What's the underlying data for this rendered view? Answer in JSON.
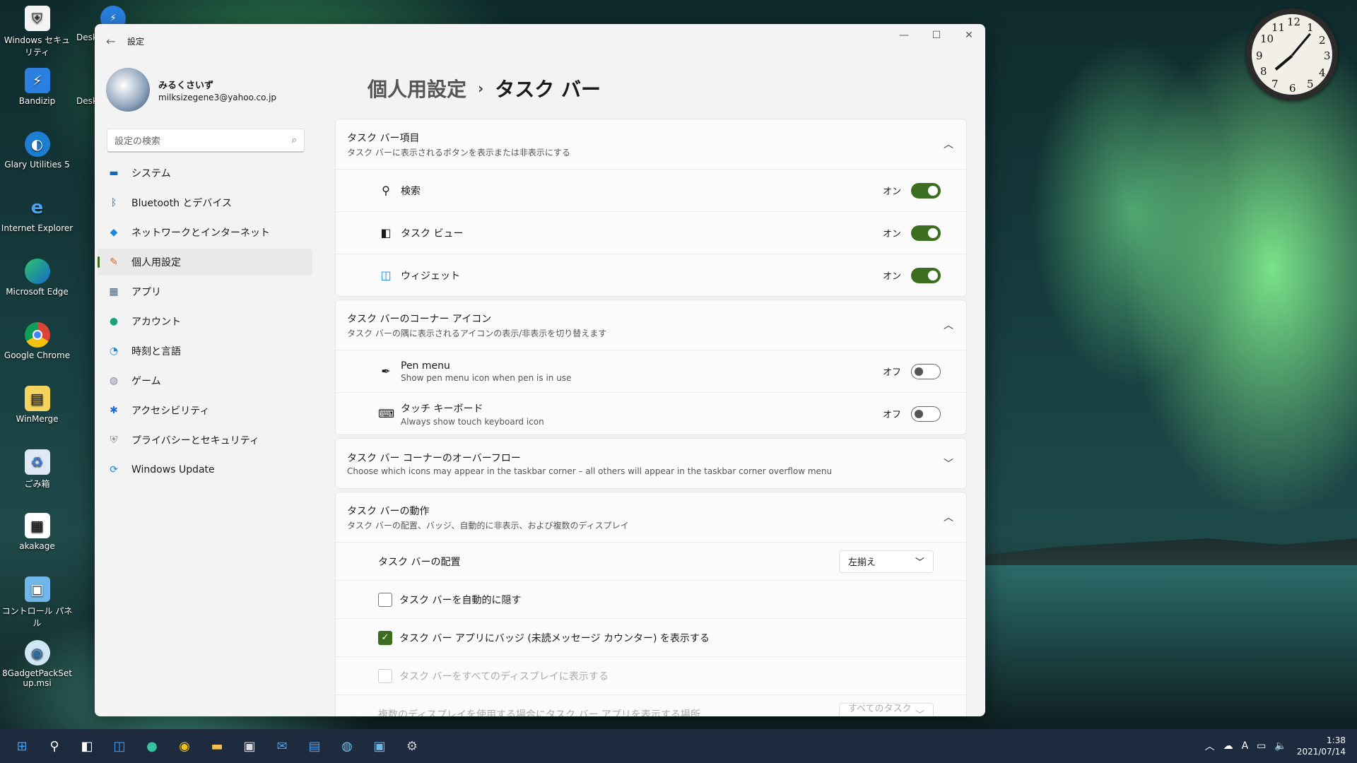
{
  "desktop": {
    "icons": [
      {
        "label": "Windows セキュリティ",
        "icon": "shield-doc-icon"
      },
      {
        "label": "Bandizip",
        "icon": "bandizip-icon"
      },
      {
        "label": "Glary Utilities 5",
        "icon": "glary-icon"
      },
      {
        "label": "Internet Explorer",
        "icon": "ie-icon"
      },
      {
        "label": "Microsoft Edge",
        "icon": "edge-icon"
      },
      {
        "label": "Google Chrome",
        "icon": "chrome-icon"
      },
      {
        "label": "WinMerge",
        "icon": "winmerge-icon"
      },
      {
        "label": "ごみ箱",
        "icon": "recycle-bin-icon"
      },
      {
        "label": "akakage",
        "icon": "akakage-icon"
      },
      {
        "label": "コントロール パネル",
        "icon": "control-panel-icon"
      },
      {
        "label": "8GadgetPackSetup.msi",
        "icon": "installer-icon"
      }
    ],
    "partial_icon_label": "Desk"
  },
  "clock_widget": {
    "numbers": [
      "12",
      "1",
      "2",
      "3",
      "4",
      "5",
      "6",
      "7",
      "8",
      "9",
      "10",
      "11"
    ]
  },
  "window": {
    "title": "設定",
    "profile": {
      "name": "みるくさいず",
      "email": "milksizegene3@yahoo.co.jp"
    },
    "search_placeholder": "設定の検索",
    "nav": [
      {
        "label": "システム",
        "icon": "system-icon",
        "color": "#0f6cbd"
      },
      {
        "label": "Bluetooth とデバイス",
        "icon": "bluetooth-icon",
        "color": "#0f6cbd"
      },
      {
        "label": "ネットワークとインターネット",
        "icon": "network-icon",
        "color": "#1b88e0"
      },
      {
        "label": "個人用設定",
        "icon": "brush-icon",
        "color": "#c46a2c"
      },
      {
        "label": "アプリ",
        "icon": "apps-icon",
        "color": "#4a5f78"
      },
      {
        "label": "アカウント",
        "icon": "account-icon",
        "color": "#1aa17b"
      },
      {
        "label": "時刻と言語",
        "icon": "time-language-icon",
        "color": "#1b88e0"
      },
      {
        "label": "ゲーム",
        "icon": "gaming-icon",
        "color": "#7a8594"
      },
      {
        "label": "アクセシビリティ",
        "icon": "accessibility-icon",
        "color": "#1b6ed6"
      },
      {
        "label": "プライバシーとセキュリティ",
        "icon": "privacy-shield-icon",
        "color": "#7d8792"
      },
      {
        "label": "Windows Update",
        "icon": "update-icon",
        "color": "#1b88e0"
      }
    ],
    "active_nav_index": 3,
    "breadcrumb": {
      "parent": "個人用設定",
      "separator": "›",
      "current": "タスク バー"
    },
    "sections": {
      "items": {
        "title": "タスク バー項目",
        "subtitle": "タスク バーに表示されるボタンを表示または非表示にする",
        "rows": [
          {
            "label": "検索",
            "state": "オン",
            "icon": "search-icon"
          },
          {
            "label": "タスク ビュー",
            "state": "オン",
            "icon": "task-view-icon"
          },
          {
            "label": "ウィジェット",
            "state": "オン",
            "icon": "widgets-icon"
          }
        ]
      },
      "corner": {
        "title": "タスク バーのコーナー アイコン",
        "subtitle": "タスク バーの隅に表示されるアイコンの表示/非表示を切り替えます",
        "rows": [
          {
            "label": "Pen menu",
            "sub": "Show pen menu icon when pen is in use",
            "state": "オフ",
            "icon": "pen-icon"
          },
          {
            "label": "タッチ キーボード",
            "sub": "Always show touch keyboard icon",
            "state": "オフ",
            "icon": "keyboard-icon"
          }
        ]
      },
      "overflow": {
        "title": "タスク バー コーナーのオーバーフロー",
        "subtitle": "Choose which icons may appear in the taskbar corner – all others will appear in the taskbar corner overflow menu"
      },
      "behaviors": {
        "title": "タスク バーの動作",
        "subtitle": "タスク バーの配置、バッジ、自動的に非表示、および複数のディスプレイ",
        "alignment_label": "タスク バーの配置",
        "alignment_value": "左揃え",
        "autohide_label": "タスク バーを自動的に隠す",
        "badges_label": "タスク バー アプリにバッジ (未読メッセージ カウンター) を表示する",
        "all_displays_label": "タスク バーをすべてのディスプレイに表示する",
        "multi_display_label": "複数のディスプレイを使用する場合にタスク バー アプリを表示する場所",
        "multi_display_value": "すべてのタスク バー"
      }
    }
  },
  "taskbar": {
    "apps": [
      "start-icon",
      "search-icon",
      "task-view-icon",
      "widgets-icon",
      "edge-icon",
      "chrome-icon",
      "explorer-icon",
      "store-icon",
      "mail-icon",
      "notepad-icon",
      "globe-icon",
      "control-panel-icon",
      "settings-icon"
    ],
    "ime": "A",
    "time": "1:38",
    "date": "2021/07/14"
  },
  "colors": {
    "accent": "#3b6e1f",
    "taskbar": "#1e2a3e"
  }
}
